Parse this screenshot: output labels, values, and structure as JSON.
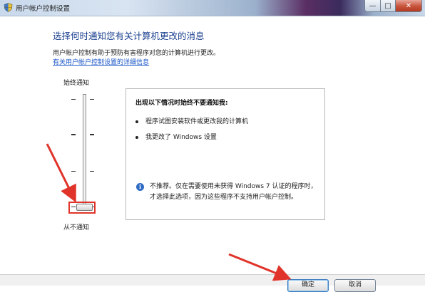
{
  "window": {
    "title": "用户帐户控制设置",
    "buttons": {
      "minimize": "—",
      "maximize": "□",
      "close": "✕"
    }
  },
  "main": {
    "heading": "选择何时通知您有关计算机更改的消息",
    "description": "用户帐户控制有助于预防有害程序对您的计算机进行更改。",
    "link": "有关用户帐户控制设置的详细信息"
  },
  "slider": {
    "top_label": "始终通知",
    "bottom_label": "从不通知",
    "levels": 4,
    "selected_level": 1
  },
  "panel": {
    "title": "出现以下情况时始终不要通知我:",
    "bullets": [
      "程序试图安装软件或更改我的计算机",
      "我更改了 Windows 设置"
    ],
    "info_icon": "info-icon",
    "info_text": "不推荐。仅在需要使用未获得 Windows 7 认证的程序时，才选择此选项，因为这些程序不支持用户帐户控制。"
  },
  "footer": {
    "ok_label": "确定",
    "cancel_label": "取消"
  },
  "annotation": {
    "color": "#e0342a"
  }
}
